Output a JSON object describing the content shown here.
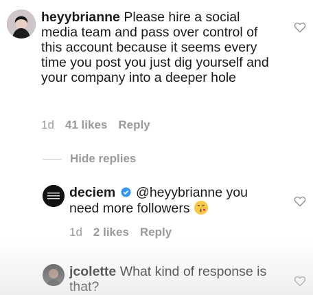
{
  "comments": [
    {
      "username": "heyybrianne",
      "text": "Please hire a social media team and pass over control of this account because it seems every time you post you just dig yourself and your company into a deeper hole",
      "age": "1d",
      "likes": "41 likes",
      "reply_label": "Reply"
    }
  ],
  "hide_replies_label": "Hide replies",
  "reply": {
    "username": "deciem",
    "mention": "@heyybrianne",
    "text": "you need more followers",
    "age": "1d",
    "likes": "2 likes",
    "reply_label": "Reply"
  },
  "last_comment": {
    "username": "jcolette",
    "text": "What kind of response is that?"
  }
}
